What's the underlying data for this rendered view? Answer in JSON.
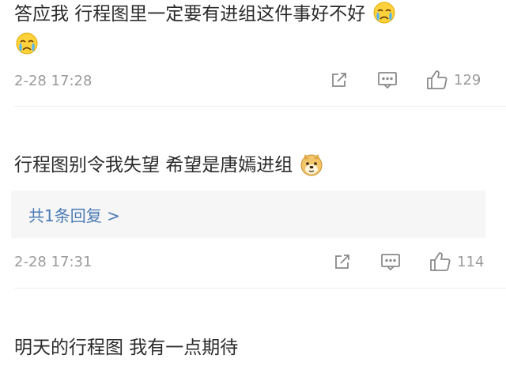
{
  "comments": [
    {
      "text_line1": "答应我 行程图里一定要有进组这件事好不好",
      "date": "2-28 17:28",
      "likes": "129",
      "emoji": "crying-face"
    },
    {
      "text_line1": "行程图别令我失望 希望是唐嫣进组",
      "date": "2-28 17:31",
      "likes": "114",
      "emoji": "doge",
      "reply_label": "共1条回复 >"
    },
    {
      "text_line1": "明天的行程图 我有一点期待"
    }
  ],
  "colors": {
    "link": "#4a7ab4",
    "meta": "#9b9b9b",
    "reply_bg": "#f6f6f6"
  },
  "icons": [
    "share-icon",
    "comment-icon",
    "like-icon"
  ]
}
